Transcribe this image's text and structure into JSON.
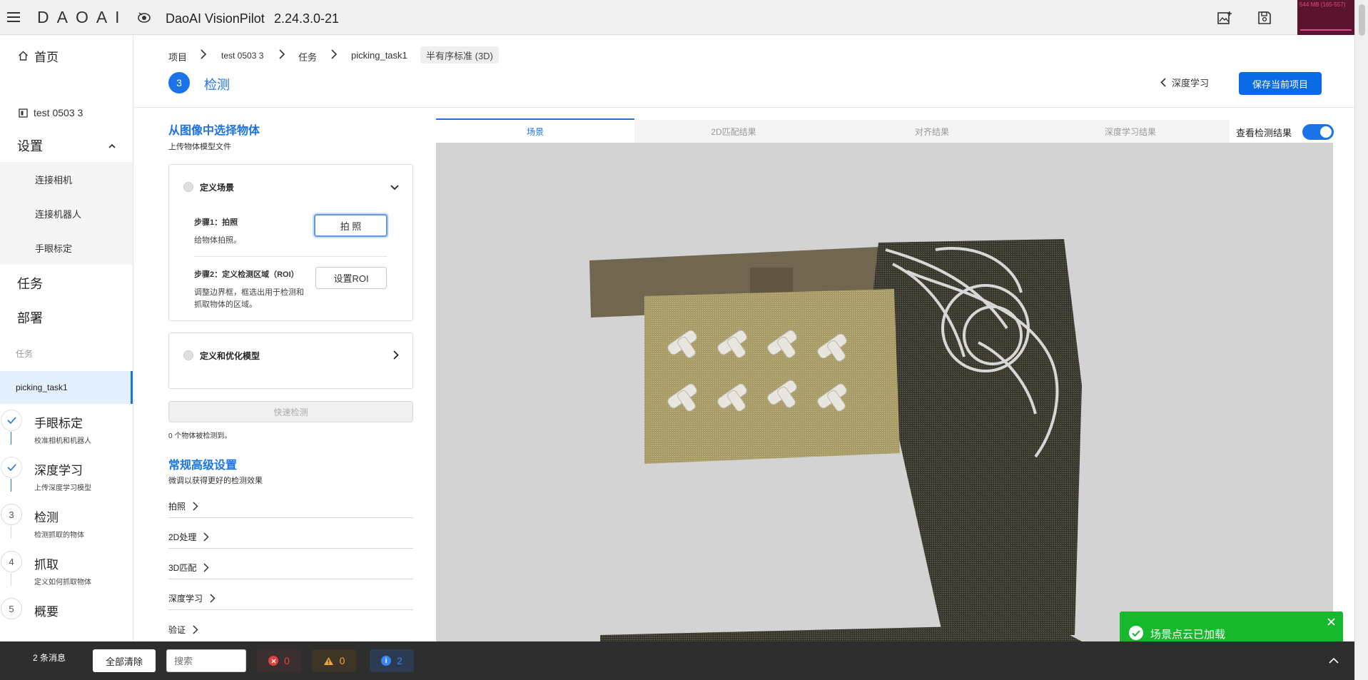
{
  "app": {
    "logo_text": "DAOAI",
    "title": "DaoAI VisionPilot",
    "version": "2.24.3.0-21",
    "memory_indicator": "544 MB (165-557)"
  },
  "sidebar": {
    "home": "首页",
    "project": "test 0503 3",
    "settings": "设置",
    "settings_items": [
      "连接相机",
      "连接机器人",
      "手眼标定"
    ],
    "tasks": "任务",
    "deploy": "部署",
    "task_section_label": "任务",
    "current_task": "picking_task1",
    "steps": [
      {
        "num": "",
        "title": "手眼标定",
        "desc": "校准相机和机器人",
        "state": "done"
      },
      {
        "num": "",
        "title": "深度学习",
        "desc": "上传深度学习模型",
        "state": "done"
      },
      {
        "num": "3",
        "title": "检测",
        "desc": "检测抓取的物体",
        "state": "current"
      },
      {
        "num": "4",
        "title": "抓取",
        "desc": "定义如何抓取物体",
        "state": "todo"
      },
      {
        "num": "5",
        "title": "概要",
        "desc": "",
        "state": "todo"
      }
    ]
  },
  "breadcrumb": {
    "items": [
      "项目",
      "test 0503 3",
      "任务",
      "picking_task1"
    ],
    "badge": "半有序标准 (3D)"
  },
  "header": {
    "step_number": "3",
    "step_title": "检测",
    "back_label": "深度学习",
    "save_label": "保存当前项目"
  },
  "left_panel": {
    "title": "从图像中选择物体",
    "subtitle": "上传物体模型文件",
    "define_scene": {
      "title": "定义场景",
      "step1_title": "步骤1：拍照",
      "step1_desc": "给物体拍照。",
      "step1_button": "拍 照",
      "step2_title": "步骤2：定义检测区域（ROI）",
      "step2_desc_line1": "调整边界框，框选出用于检测和",
      "step2_desc_line2": "抓取物体的区域。",
      "step2_button": "设置ROI"
    },
    "define_model": {
      "title": "定义和优化模型"
    },
    "quick_detect": "快速检测",
    "detected_count": "0 个物体被检测到。",
    "advanced": {
      "title": "常规高级设置",
      "subtitle": "微调以获得更好的检测效果",
      "rows": [
        "拍照",
        "2D处理",
        "3D匹配",
        "深度学习",
        "验证"
      ]
    }
  },
  "viewer": {
    "tabs": [
      "场景",
      "2D匹配结果",
      "对齐结果",
      "深度学习结果"
    ],
    "active_tab": 0,
    "toggle_label": "查看检测结果",
    "toggle_on": true,
    "background_color": "#d3d3d3"
  },
  "toast": {
    "message": "场景点云已加载",
    "color": "#18b82c"
  },
  "bottom_bar": {
    "message_count": "2 条消息",
    "clear_all": "全部清除",
    "search_placeholder": "搜索",
    "errors": "0",
    "warnings": "0",
    "infos": "2"
  },
  "colors": {
    "accent": "#1a73e8",
    "primary_button": "#0b6be6"
  }
}
